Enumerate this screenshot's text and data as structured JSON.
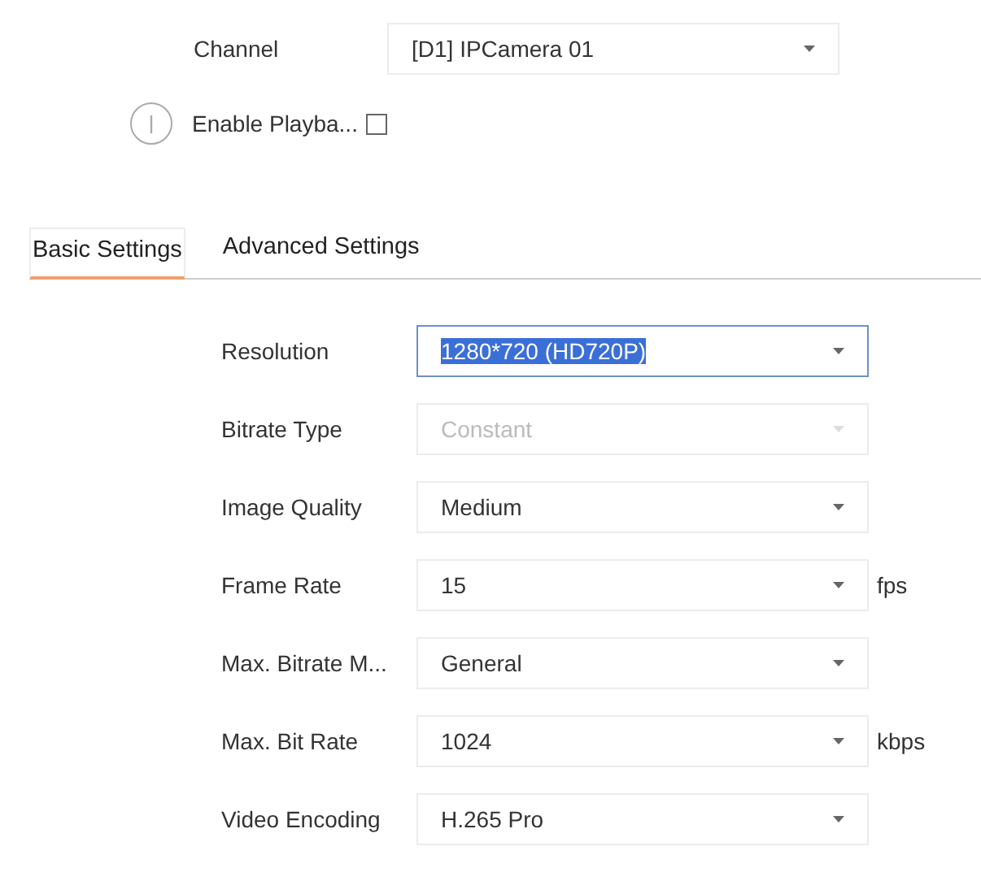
{
  "channel": {
    "label": "Channel",
    "value": "[D1] IPCamera 01"
  },
  "enable_playback": {
    "label": "Enable Playba...",
    "checked": false
  },
  "tabs": [
    {
      "label": "Basic Settings",
      "selected": true
    },
    {
      "label": "Advanced Settings",
      "selected": false
    }
  ],
  "fields": [
    {
      "label": "Resolution",
      "value": "1280*720 (HD720P)",
      "focused": true,
      "disabled": false
    },
    {
      "label": "Bitrate Type",
      "value": "Constant",
      "focused": false,
      "disabled": true
    },
    {
      "label": "Image Quality",
      "value": "Medium",
      "focused": false,
      "disabled": false
    },
    {
      "label": "Frame Rate",
      "value": "15",
      "unit": "fps",
      "focused": false,
      "disabled": false
    },
    {
      "label": "Max. Bitrate M...",
      "value": "General",
      "focused": false,
      "disabled": false
    },
    {
      "label": "Max. Bit Rate",
      "value": "1024",
      "unit": "kbps",
      "focused": false,
      "disabled": false
    },
    {
      "label": "Video Encoding",
      "value": "H.265 Pro",
      "focused": false,
      "disabled": false
    }
  ]
}
